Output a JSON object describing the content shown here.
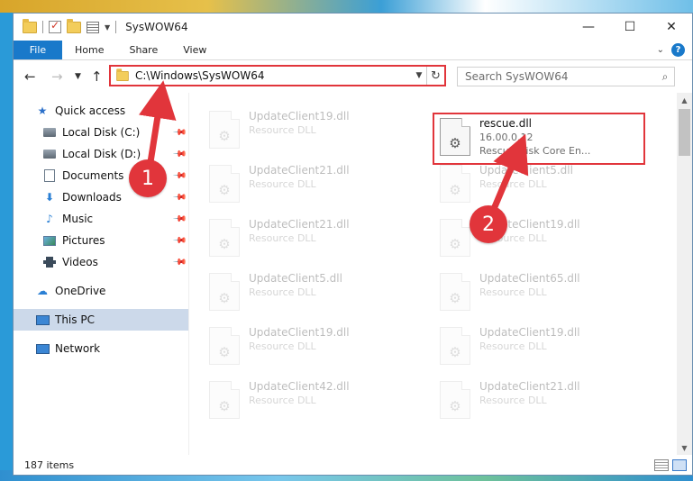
{
  "window": {
    "title": "SysWOW64"
  },
  "window_controls": {
    "minimize": "—",
    "maximize": "☐",
    "close": "✕"
  },
  "ribbon": {
    "tabs": [
      {
        "label": "File"
      },
      {
        "label": "Home"
      },
      {
        "label": "Share"
      },
      {
        "label": "View"
      }
    ],
    "help": "?"
  },
  "navbar": {
    "address": "C:\\Windows\\SysWOW64",
    "search_placeholder": "Search SysWOW64"
  },
  "sidebar": {
    "items": [
      {
        "label": "Quick access",
        "icon": "star-icon",
        "pinned": false
      },
      {
        "label": "Local Disk (C:)",
        "icon": "disk-icon",
        "pinned": true
      },
      {
        "label": "Local Disk (D:)",
        "icon": "disk-icon",
        "pinned": true
      },
      {
        "label": "Documents",
        "icon": "documents-icon",
        "pinned": true
      },
      {
        "label": "Downloads",
        "icon": "download-icon",
        "pinned": true
      },
      {
        "label": "Music",
        "icon": "music-icon",
        "pinned": true
      },
      {
        "label": "Pictures",
        "icon": "pictures-icon",
        "pinned": true
      },
      {
        "label": "Videos",
        "icon": "videos-icon",
        "pinned": true
      },
      {
        "label": "OneDrive",
        "icon": "cloud-icon"
      },
      {
        "label": "This PC",
        "icon": "computer-icon",
        "selected": true
      },
      {
        "label": "Network",
        "icon": "network-icon"
      }
    ]
  },
  "files": {
    "left": [
      {
        "name": "UpdateClient19.dll",
        "type": "Resource DLL"
      },
      {
        "name": "UpdateClient21.dll",
        "type": "Resource DLL"
      },
      {
        "name": "UpdateClient21.dll",
        "type": "Resource DLL"
      },
      {
        "name": "UpdateClient5.dll",
        "type": "Resource DLL"
      },
      {
        "name": "UpdateClient19.dll",
        "type": "Resource DLL"
      },
      {
        "name": "UpdateClient42.dll",
        "type": "Resource DLL"
      }
    ],
    "highlighted": {
      "name": "rescue.dll",
      "version": "16.00.0.12",
      "description": "Rescue Disk Core En..."
    },
    "right": [
      {
        "name": "UpdateClient5.dll",
        "type": "Resource DLL"
      },
      {
        "name": "UpdateClient19.dll",
        "type": "Resource DLL"
      },
      {
        "name": "UpdateClient65.dll",
        "type": "Resource DLL"
      },
      {
        "name": "UpdateClient19.dll",
        "type": "Resource DLL"
      },
      {
        "name": "UpdateClient21.dll",
        "type": "Resource DLL"
      }
    ]
  },
  "status": {
    "item_count": "187 items"
  },
  "annotations": {
    "step1": "1",
    "step2": "2",
    "color": "#e1353b"
  }
}
